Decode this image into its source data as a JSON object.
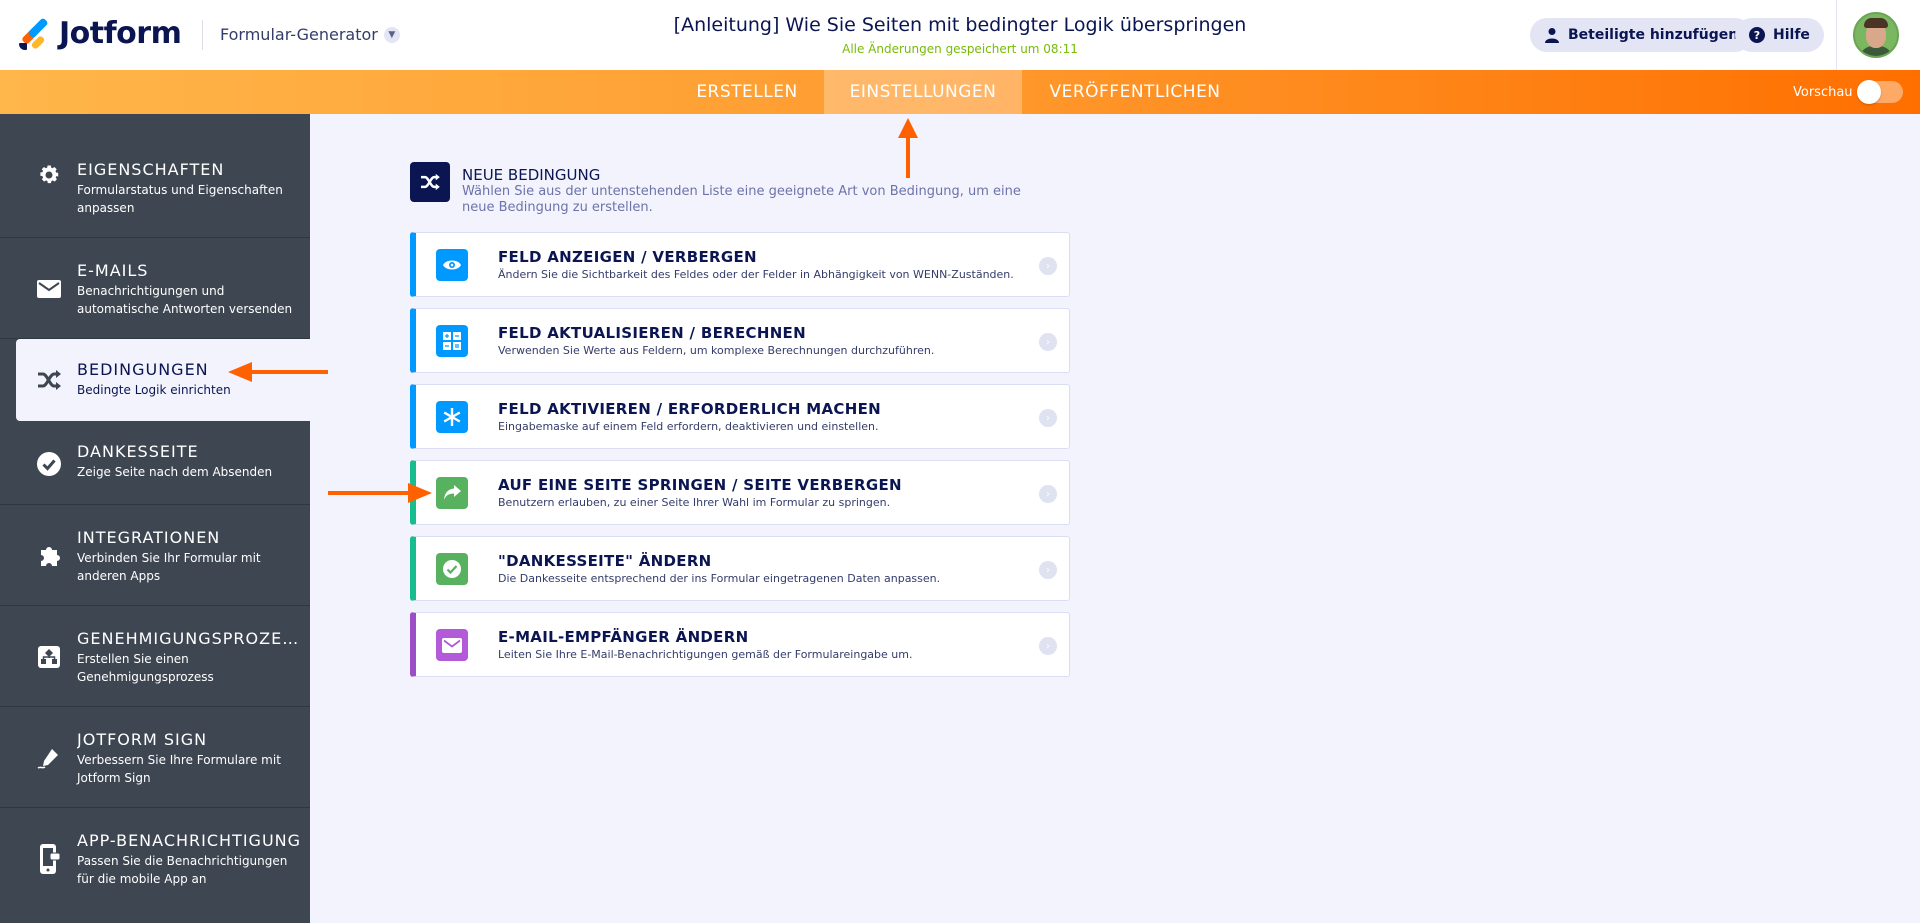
{
  "header": {
    "logo_text": "Jotform",
    "form_builder_label": "Formular-Generator",
    "page_title": "[Anleitung] Wie Sie Seiten mit bedingter Logik überspringen",
    "saved_status": "Alle Änderungen gespeichert um 08:11",
    "add_participants_label": "Beteiligte hinzufügen",
    "help_label": "Hilfe"
  },
  "nav": {
    "tabs": [
      {
        "label": "ERSTELLEN",
        "active": false
      },
      {
        "label": "EINSTELLUNGEN",
        "active": true
      },
      {
        "label": "VERÖFFENTLICHEN",
        "active": false
      }
    ],
    "preview_label": "Vorschau",
    "preview_on": false
  },
  "sidebar": {
    "items": [
      {
        "title": "EIGENSCHAFTEN",
        "desc": "Formularstatus und Eigenschaften anpassen",
        "icon": "gear-icon",
        "active": false
      },
      {
        "title": "E-MAILS",
        "desc": "Benachrichtigungen und automatische Antworten versenden",
        "icon": "envelope-icon",
        "active": false
      },
      {
        "title": "BEDINGUNGEN",
        "desc": "Bedingte Logik einrichten",
        "icon": "shuffle-icon",
        "active": true
      },
      {
        "title": "DANKESSEITE",
        "desc": "Zeige Seite nach dem Absenden",
        "icon": "check-circle-icon",
        "active": false
      },
      {
        "title": "INTEGRATIONEN",
        "desc": "Verbinden Sie Ihr Formular mit anderen Apps",
        "icon": "puzzle-icon",
        "active": false
      },
      {
        "title": "GENEHMIGUNGSPROZESS",
        "desc": "Erstellen Sie einen Genehmigungsprozess",
        "icon": "workflow-icon",
        "active": false
      },
      {
        "title": "JOTFORM SIGN",
        "desc": "Verbessern Sie Ihre Formulare mit Jotform Sign",
        "icon": "pen-icon",
        "active": false
      },
      {
        "title": "APP-BENACHRICHTIGUNG",
        "desc": "Passen Sie die Benachrichtigungen für die mobile App an",
        "icon": "mobile-icon",
        "active": false
      }
    ]
  },
  "main": {
    "title": "NEUE BEDINGUNG",
    "desc": "Wählen Sie aus der untenstehenden Liste eine geeignete Art von Bedingung, um eine neue Bedingung zu erstellen.",
    "conditions": [
      {
        "title": "FELD ANZEIGEN / VERBERGEN",
        "desc": "Ändern Sie die Sichtbarkeit des Feldes oder der Felder in Abhängigkeit von WENN-Zuständen.",
        "icon": "eye-icon",
        "color": "#0099ff",
        "accent": "#0099ff"
      },
      {
        "title": "FELD AKTUALISIEREN / BERECHNEN",
        "desc": "Verwenden Sie Werte aus Feldern, um komplexe Berechnungen durchzuführen.",
        "icon": "calculator-icon",
        "color": "#0099ff",
        "accent": "#0099ff"
      },
      {
        "title": "FELD AKTIVIEREN / ERFORDERLICH MACHEN",
        "desc": "Eingabemaske auf einem Feld erfordern, deaktivieren und einstellen.",
        "icon": "asterisk-icon",
        "color": "#0099ff",
        "accent": "#0099ff"
      },
      {
        "title": "AUF EINE SEITE SPRINGEN / SEITE VERBERGEN",
        "desc": "Benutzern erlauben, zu einer Seite Ihrer Wahl im Formular zu springen.",
        "icon": "share-arrow-icon",
        "color": "#58b15e",
        "accent": "#18bd8f"
      },
      {
        "title": "\"DANKESSEITE\" ÄNDERN",
        "desc": "Die Dankesseite entsprechend der ins Formular eingetragenen Daten anpassen.",
        "icon": "check-circle-icon",
        "color": "#58b15e",
        "accent": "#18bd8f"
      },
      {
        "title": "E-MAIL-EMPFÄNGER ÄNDERN",
        "desc": "Leiten Sie Ihre E-Mail-Benachrichtigungen gemäß der Formulareingabe um.",
        "icon": "envelope-icon",
        "color": "#b25ad8",
        "accent": "#9c4dc8"
      }
    ]
  },
  "colors": {
    "navy": "#0a1551",
    "sidebar_bg": "#3e4652",
    "orange": "#ff6f00",
    "annotation_arrow": "#ff6100"
  }
}
